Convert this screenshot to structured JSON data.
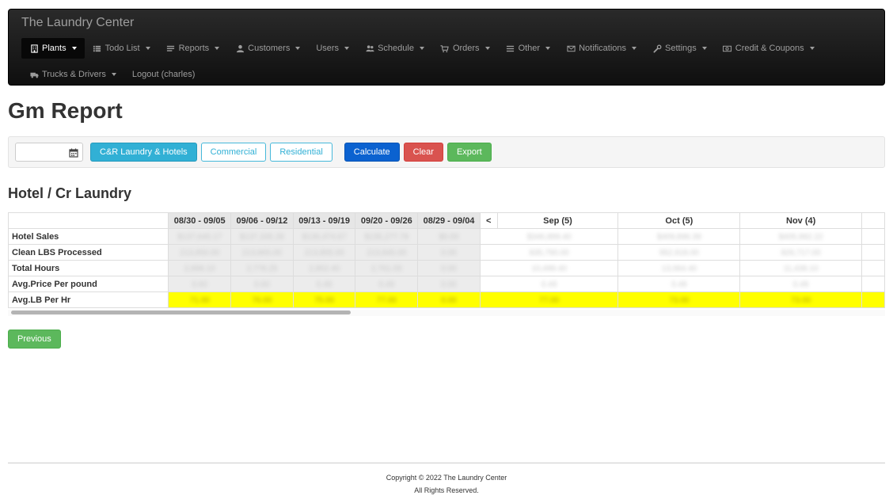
{
  "brand": "The Laundry Center",
  "nav": {
    "row1": [
      {
        "label": "Plants",
        "icon": "building-icon",
        "caret": true,
        "active": true
      },
      {
        "label": "Todo List",
        "icon": "list-icon",
        "caret": true
      },
      {
        "label": "Reports",
        "icon": "report-icon",
        "caret": true
      },
      {
        "label": "Customers",
        "icon": "user-icon",
        "caret": true
      },
      {
        "label": "Users",
        "icon": "",
        "caret": true
      },
      {
        "label": "Schedule",
        "icon": "users-icon",
        "caret": true
      },
      {
        "label": "Orders",
        "icon": "cart-icon",
        "caret": true
      },
      {
        "label": "Other",
        "icon": "menu-icon",
        "caret": true
      },
      {
        "label": "Notifications",
        "icon": "envelope-icon",
        "caret": true
      },
      {
        "label": "Settings",
        "icon": "wrench-icon",
        "caret": true
      },
      {
        "label": "Credit & Coupons",
        "icon": "money-icon",
        "caret": true
      }
    ],
    "row2": [
      {
        "label": "Trucks & Drivers",
        "icon": "truck-icon",
        "caret": true
      },
      {
        "label": "Logout (charles)",
        "icon": "",
        "caret": false
      }
    ]
  },
  "page_title": "Gm Report",
  "toolbar": {
    "date_value": "",
    "btn_cr": "C&R Laundry & Hotels",
    "btn_commercial": "Commercial",
    "btn_residential": "Residential",
    "btn_calculate": "Calculate",
    "btn_clear": "Clear",
    "btn_export": "Export"
  },
  "section_title": "Hotel / Cr Laundry",
  "table": {
    "week_headers": [
      "08/30 - 09/05",
      "09/06 - 09/12",
      "09/13 - 09/19",
      "09/20 - 09/26",
      "08/29 - 09/04"
    ],
    "arrow": "<",
    "month_headers": [
      "Sep (5)",
      "Oct (5)",
      "Nov (4)"
    ],
    "rows": [
      {
        "label": "Hotel Sales",
        "weeks": [
          "$137,645.17",
          "$137,335.28",
          "$136,474.67",
          "$135,277.78",
          "$0.00"
        ],
        "months": [
          "$346,899.40",
          "$409,896.39",
          "$405,992.22"
        ]
      },
      {
        "label": "Clean LBS Processed",
        "weeks": [
          "213,850.00",
          "213,865.00",
          "213,855.00",
          "213,845.00",
          "0.00"
        ],
        "months": [
          "835,790.00",
          "952,918.00",
          "826,717.00"
        ]
      },
      {
        "label": "Total Hours",
        "weeks": [
          "2,898.10",
          "2,778.25",
          "2,852.40",
          "2,761.05",
          "0.00"
        ],
        "months": [
          "10,499.40",
          "13,064.40",
          "11,439.10"
        ]
      },
      {
        "label": "Avg.Price Per pound",
        "weeks": [
          "0.60",
          "0.60",
          "0.49",
          "0.49",
          "0.00"
        ],
        "months": [
          "0.49",
          "0.49",
          "0.49"
        ]
      },
      {
        "label": "Avg.LB Per Hr",
        "weeks": [
          "71.00",
          "76.00",
          "75.00",
          "77.00",
          "0.00"
        ],
        "months": [
          "77.00",
          "73.00",
          "73.00"
        ],
        "highlight": true
      }
    ]
  },
  "previous_label": "Previous",
  "footer": {
    "copyright": "Copyright © 2022 The Laundry Center",
    "rights": "All Rights Reserved."
  },
  "colors": {
    "navbar": "#1b1b1b",
    "info": "#31b0d5",
    "primary": "#0b62d0",
    "danger": "#d9534f",
    "success": "#5cb85c",
    "highlight": "#ffff00"
  }
}
